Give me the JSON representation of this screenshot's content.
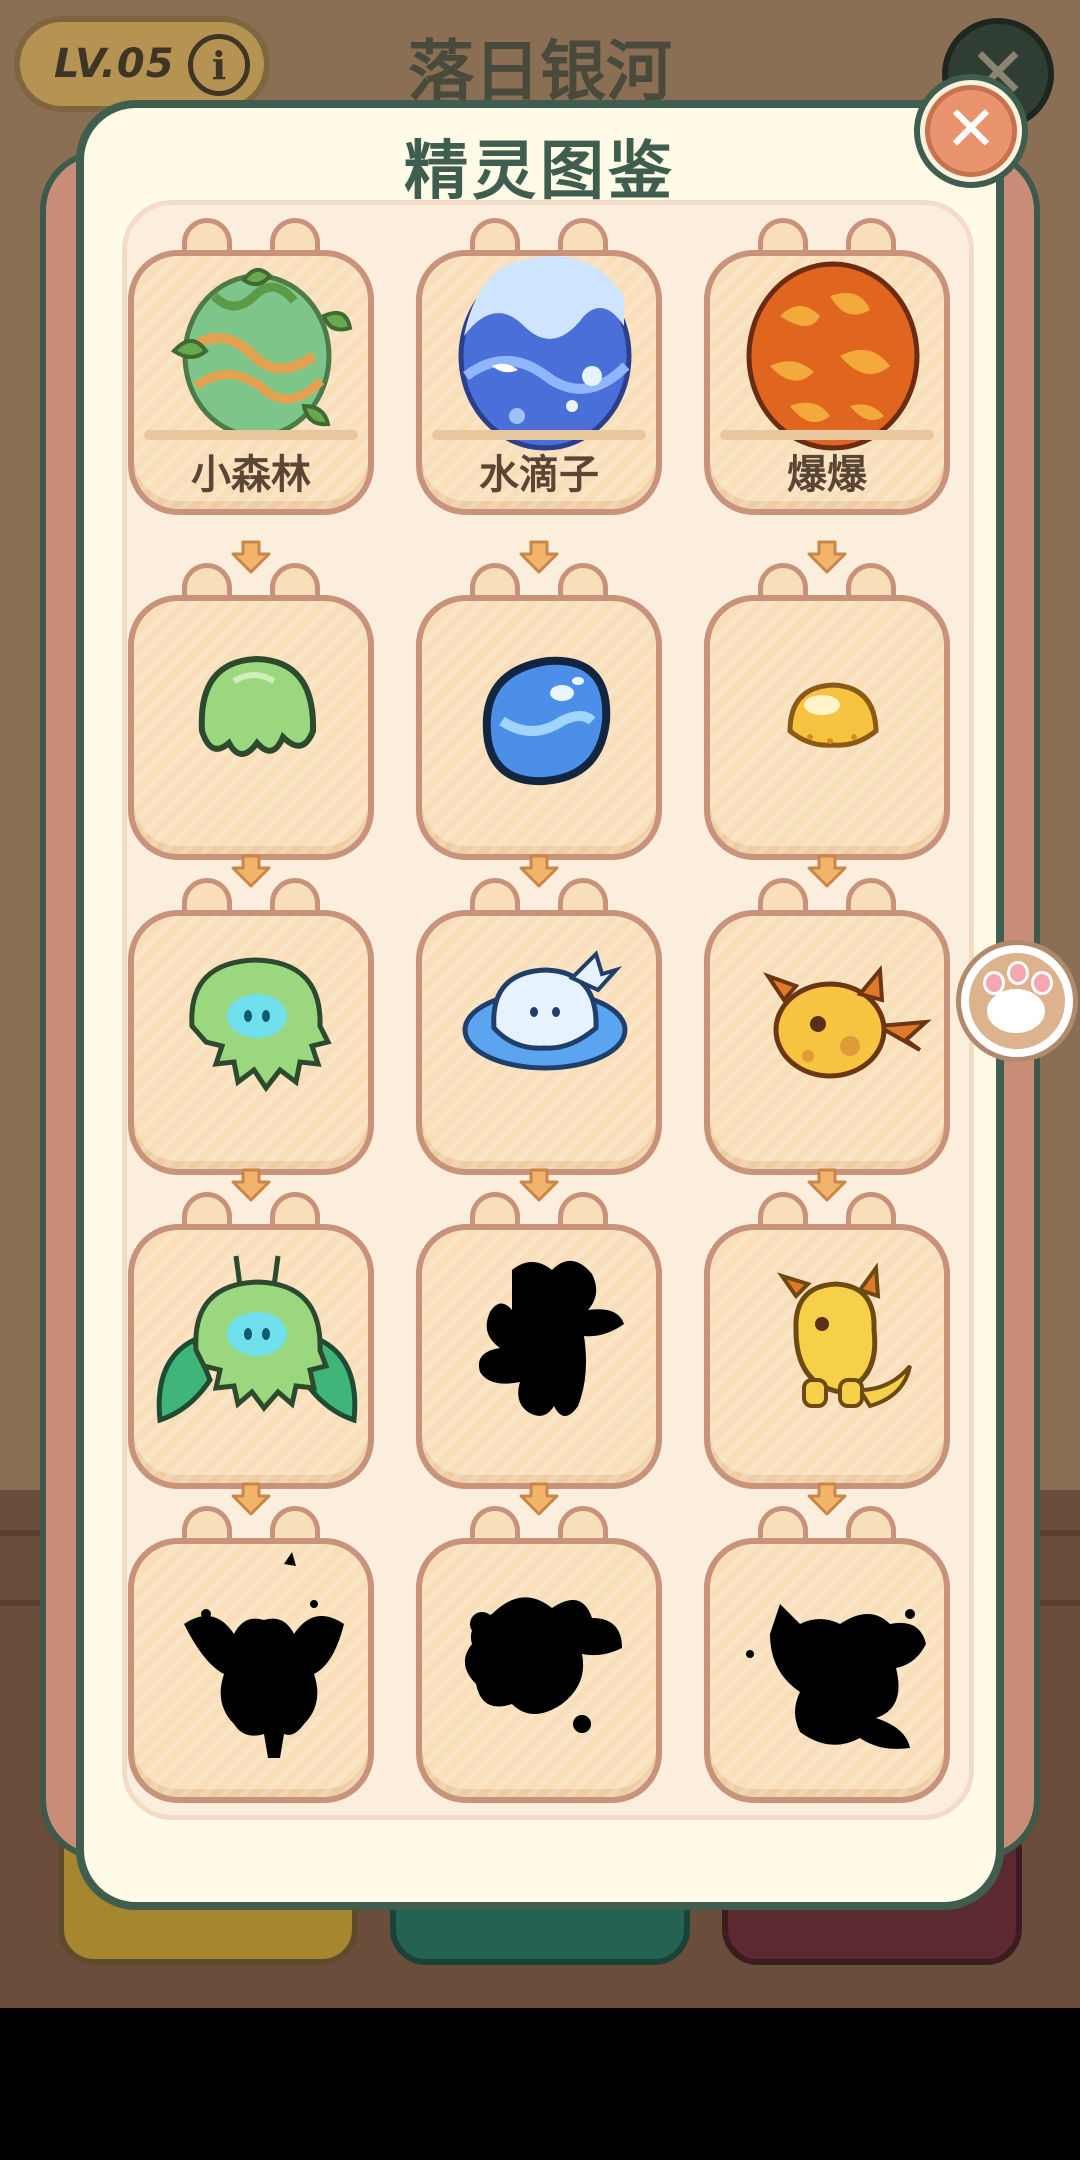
{
  "background": {
    "level_label": "LV.05",
    "info_glyph": "i",
    "world_title": "落日银河",
    "close_glyph": "✕"
  },
  "modal": {
    "title": "精灵图鉴",
    "close_glyph": "✕",
    "side_button_icon": "paw-icon"
  },
  "spirits": {
    "eggs": [
      {
        "name": "小森林",
        "icon": "forest-egg-icon"
      },
      {
        "name": "水滴子",
        "icon": "water-egg-icon"
      },
      {
        "name": "爆爆",
        "icon": "fire-egg-icon"
      }
    ],
    "stage2": [
      {
        "icon": "green-sprout-creature-icon",
        "unlocked": true
      },
      {
        "icon": "blue-water-drop-creature-icon",
        "unlocked": true
      },
      {
        "icon": "yellow-fire-drop-creature-icon",
        "unlocked": true
      }
    ],
    "stage3": [
      {
        "icon": "green-fluffy-creature-icon",
        "unlocked": true
      },
      {
        "icon": "blue-cloud-creature-icon",
        "unlocked": true
      },
      {
        "icon": "orange-horned-creature-icon",
        "unlocked": true
      }
    ],
    "stage4": [
      {
        "icon": "green-leaf-winged-creature-icon",
        "unlocked": true
      },
      {
        "icon": "locked-silhouette-icon",
        "unlocked": false
      },
      {
        "icon": "yellow-dino-creature-icon",
        "unlocked": true
      }
    ],
    "stage5": [
      {
        "icon": "locked-silhouette-icon",
        "unlocked": false
      },
      {
        "icon": "locked-silhouette-icon",
        "unlocked": false
      },
      {
        "icon": "locked-silhouette-icon",
        "unlocked": false
      }
    ]
  }
}
